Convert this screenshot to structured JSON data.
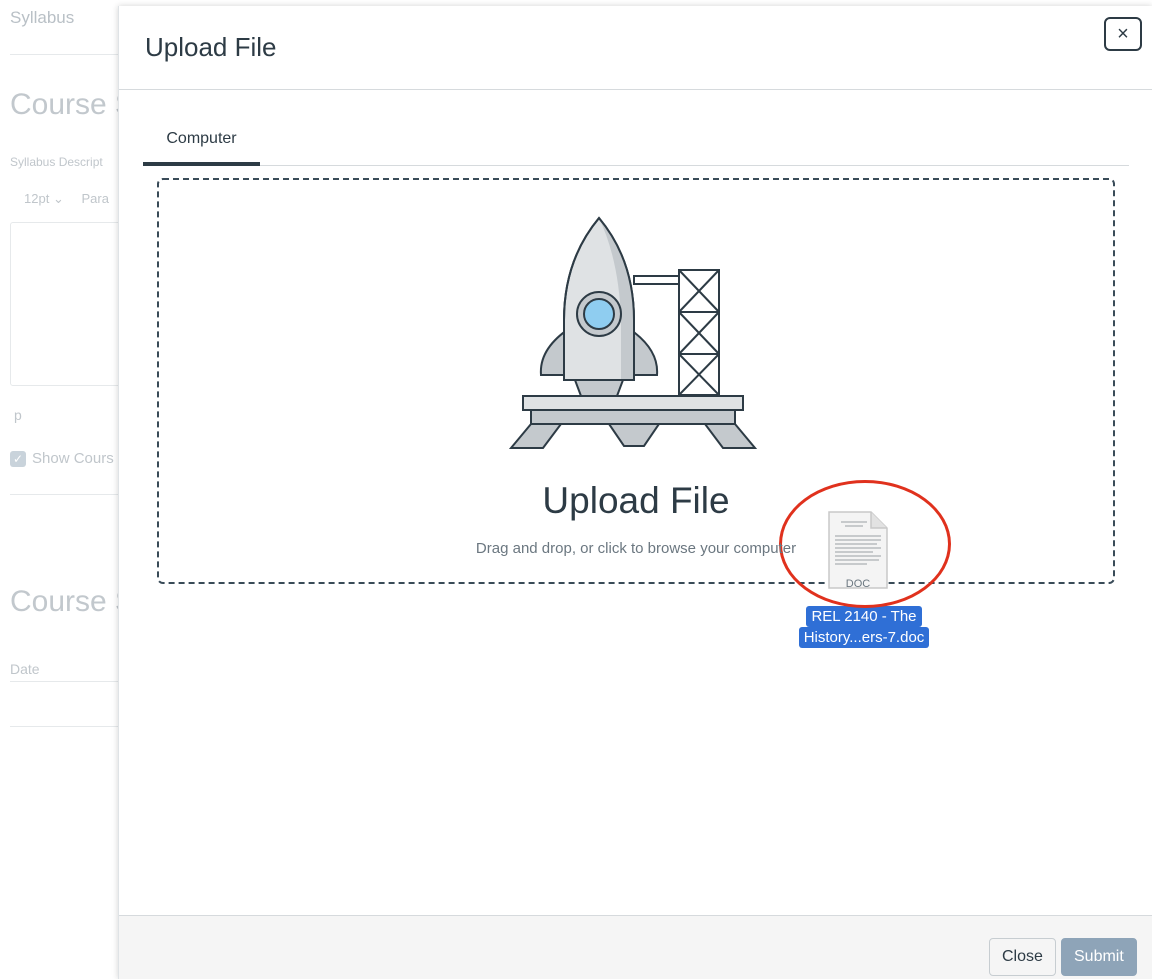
{
  "background": {
    "syllabus_link": "Syllabus",
    "heading_1": "Course S",
    "syllabus_description_label": "Syllabus Descript",
    "font_size": "12pt",
    "paragraph_partial": "Para",
    "path_tag": "p",
    "show_course_label": "Show Cours",
    "heading_2": "Course S",
    "date_column": "Date"
  },
  "modal": {
    "title": "Upload File",
    "close_icon": "×",
    "tabs": [
      {
        "label": "Computer",
        "active": true
      }
    ],
    "dropzone": {
      "title": "Upload File",
      "subtitle": "Drag and drop, or click to browse your computer",
      "dragged_file": {
        "icon_label": "DOC",
        "name_line_1": "REL 2140 - The",
        "name_line_2": "History...ers-7.doc"
      }
    },
    "footer": {
      "close_label": "Close",
      "submit_label": "Submit"
    }
  },
  "colors": {
    "primary_text": "#2d3b45",
    "submit_disabled": "#8ea4b8",
    "drag_label_bg": "#2f6fd6",
    "annotation_circle": "#e0311d"
  }
}
